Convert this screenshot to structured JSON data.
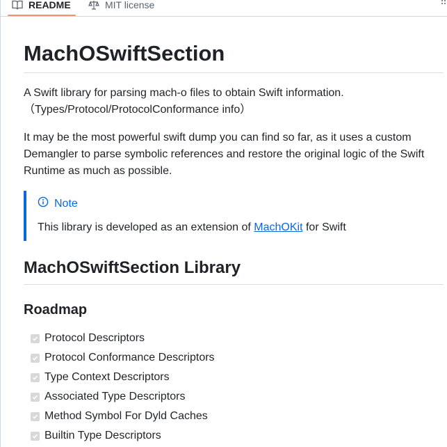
{
  "tabs": {
    "readme_label": "README",
    "license_label": "MIT license"
  },
  "readme": {
    "title": "MachOSwiftSection",
    "intro_line1": "A Swift library for parsing mach-o files to obtain Swift information.",
    "intro_line2": "（Types/Protocol/ProtocolConformance info）",
    "description": "It may be the most powerful swift dump you can find so far, as it uses a custom Demangler to parse symbolic references and restore the original logic of the Swift Runtime as much as possible.",
    "note": {
      "title": "Note",
      "text_before": "This library is developed as an extension of ",
      "link_text": "MachOKit",
      "text_after": " for Swift"
    },
    "library_heading": "MachOSwiftSection Library",
    "roadmap_heading": "Roadmap",
    "roadmap_items": [
      {
        "label": "Protocol Descriptors",
        "checked": true
      },
      {
        "label": "Protocol Conformance Descriptors",
        "checked": true
      },
      {
        "label": "Type Context Descriptors",
        "checked": true
      },
      {
        "label": "Associated Type Descriptors",
        "checked": true
      },
      {
        "label": "Method Symbol For Dyld Caches",
        "checked": true
      },
      {
        "label": "Builtin Type Descriptors",
        "checked": true
      }
    ]
  },
  "colors": {
    "accent": "#0969da",
    "tab_underline": "#fd8c73",
    "text": "#1f2328"
  }
}
